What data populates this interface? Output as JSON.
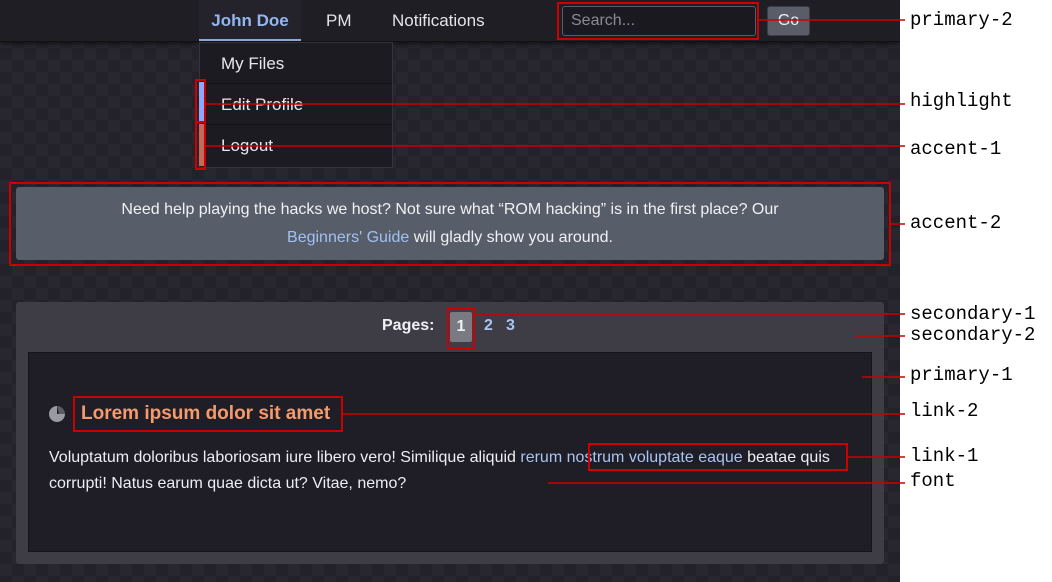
{
  "navbar": {
    "user_label": "John Doe",
    "pm_label": "PM",
    "notifications_label": "Notifications",
    "search_placeholder": "Search...",
    "go_label": "Go"
  },
  "dropdown": {
    "items": [
      {
        "label": "My Files"
      },
      {
        "label": "Edit Profile"
      },
      {
        "label": "Logout"
      }
    ]
  },
  "notice": {
    "text_before": "Need help playing the hacks we host? Not sure what “ROM hacking” is in the first place? Our",
    "link": "Beginners' Guide",
    "text_after": " will gladly show you around."
  },
  "pagination": {
    "label": "Pages:",
    "current": "1",
    "pages": [
      "2",
      "3"
    ]
  },
  "post": {
    "title": "Lorem ipsum dolor sit amet",
    "body_before": "Voluptatum doloribus laboriosam iure libero vero! Similique aliquid ",
    "body_link": "rerum nostrum voluptate eaque",
    "body_after": " beatae quis corrupti! Natus earum quae dicta ut? Vitae, nemo?"
  },
  "annotations": [
    {
      "label": "primary-2"
    },
    {
      "label": "highlight"
    },
    {
      "label": "accent-1"
    },
    {
      "label": "accent-2"
    },
    {
      "label": "secondary-1"
    },
    {
      "label": "secondary-2"
    },
    {
      "label": "primary-1"
    },
    {
      "label": "link-2"
    },
    {
      "label": "link-1"
    },
    {
      "label": "font"
    }
  ],
  "colors": {
    "primary_1": "#1f1e26",
    "primary_2": "#1f1e25",
    "secondary_1": "#7a7a82",
    "secondary_2": "#3e3d45",
    "accent_1": "#c46a5a",
    "accent_2": "#575d69",
    "highlight": "#8da9ff",
    "link_1": "#a8c4f0",
    "link_2": "#f59a6c",
    "font": "#eceef2",
    "annotation": "#cc0000"
  }
}
